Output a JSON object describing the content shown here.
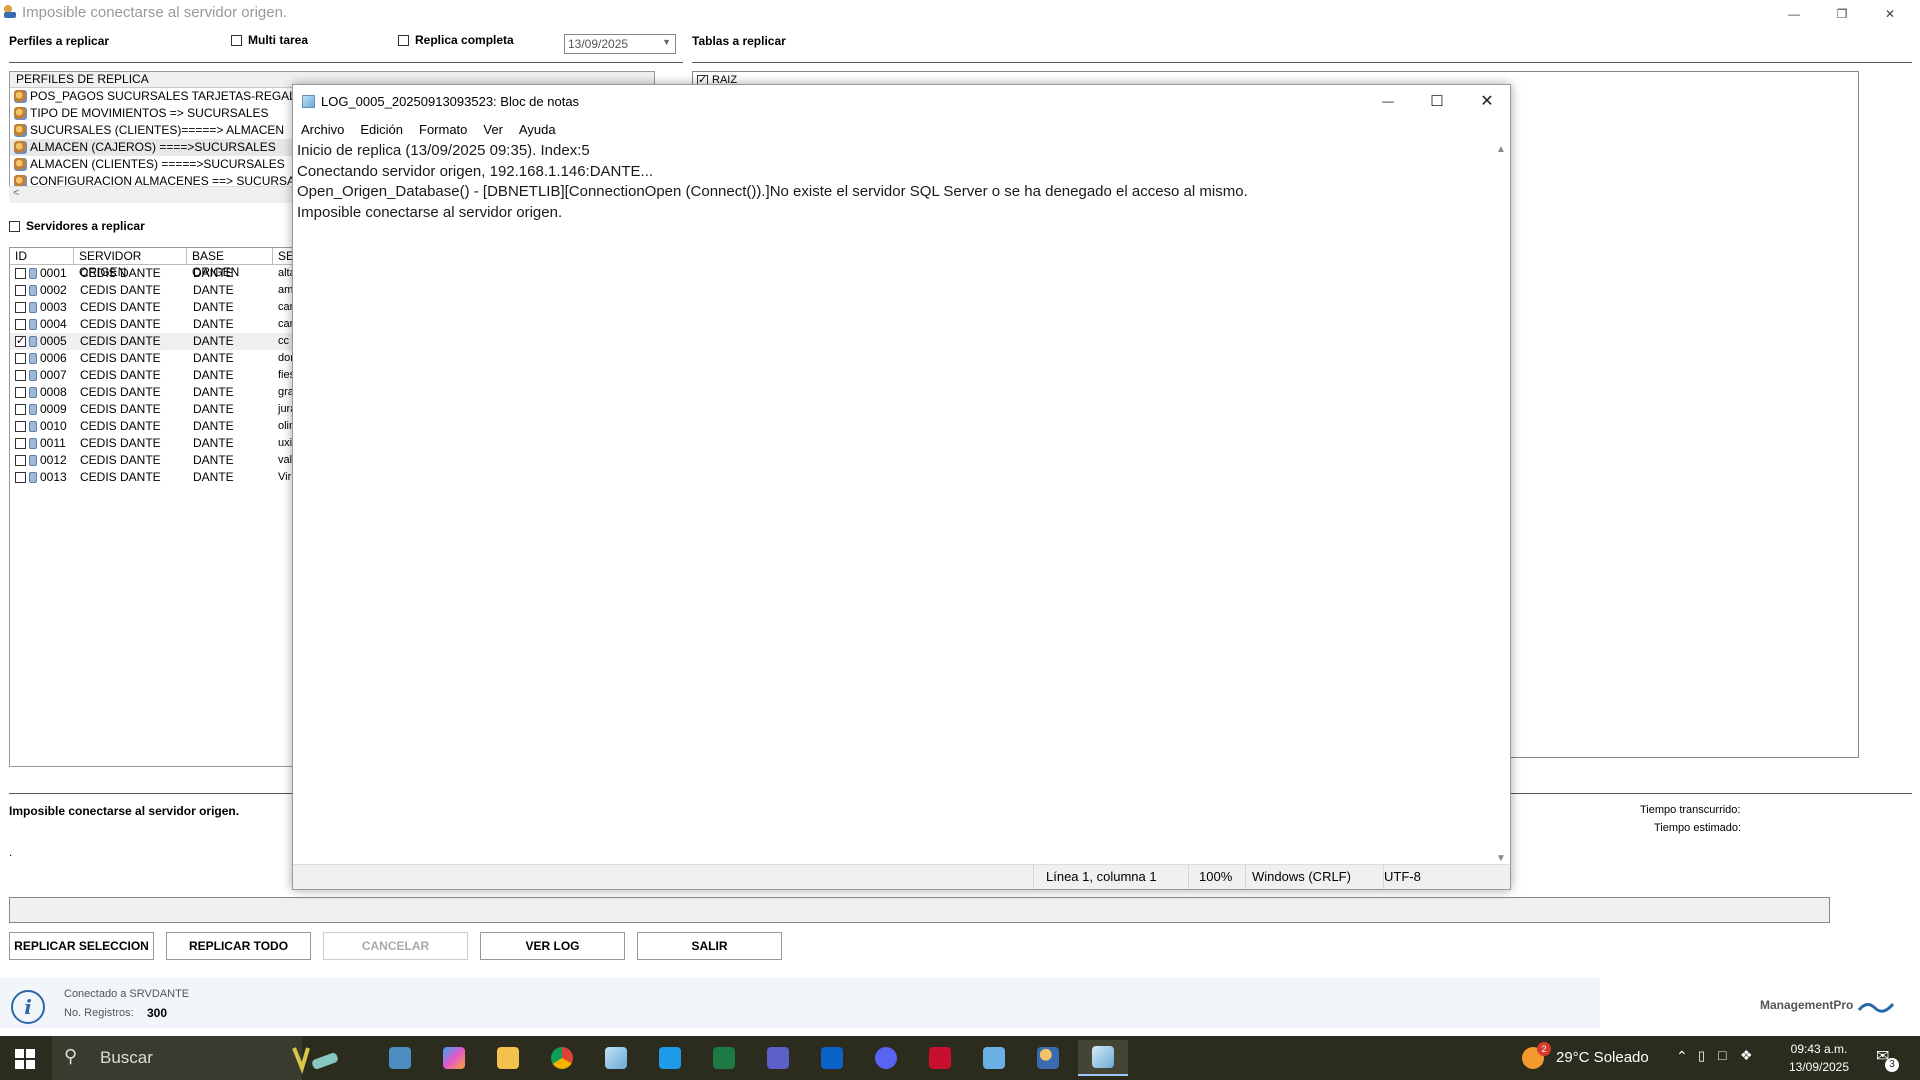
{
  "window": {
    "title": "Imposible conectarse al servidor origen."
  },
  "top": {
    "perfiles_label": "Perfiles a replicar",
    "multi_tarea": "Multi tarea",
    "replica_completa": "Replica completa",
    "date": "13/09/2025",
    "tablas_label": "Tablas a replicar",
    "servidores_label": "Servidores a replicar"
  },
  "profiles": {
    "header": "PERFILES DE REPLICA",
    "items": [
      "POS_PAGOS SUCURSALES TARJETAS-REGALO=>A",
      "TIPO DE MOVIMIENTOS => SUCURSALES",
      "SUCURSALES (CLIENTES)=====> ALMACEN",
      "ALMACEN (CAJEROS) ====>SUCURSALES",
      "ALMACEN  (CLIENTES) =====>SUCURSALES",
      "CONFIGURACION ALMACENES ==> SUCURSALES"
    ]
  },
  "tablas": {
    "root": "RAIZ"
  },
  "servers": {
    "headers": [
      "ID",
      "SERVIDOR ORIGEN",
      "BASE ORIGEN",
      "SE"
    ],
    "rows": [
      {
        "id": "0001",
        "srv": "CEDIS DANTE",
        "base": "DANTE",
        "se": "alta",
        "checked": false
      },
      {
        "id": "0002",
        "srv": "CEDIS DANTE",
        "base": "DANTE",
        "se": "am",
        "checked": false
      },
      {
        "id": "0003",
        "srv": "CEDIS DANTE",
        "base": "DANTE",
        "se": "car",
        "checked": false
      },
      {
        "id": "0004",
        "srv": "CEDIS DANTE",
        "base": "DANTE",
        "se": "car",
        "checked": false
      },
      {
        "id": "0005",
        "srv": "CEDIS DANTE",
        "base": "DANTE",
        "se": "cc",
        "checked": true
      },
      {
        "id": "0006",
        "srv": "CEDIS DANTE",
        "base": "DANTE",
        "se": "dor",
        "checked": false
      },
      {
        "id": "0007",
        "srv": "CEDIS DANTE",
        "base": "DANTE",
        "se": "fies",
        "checked": false
      },
      {
        "id": "0008",
        "srv": "CEDIS DANTE",
        "base": "DANTE",
        "se": "gra",
        "checked": false
      },
      {
        "id": "0009",
        "srv": "CEDIS DANTE",
        "base": "DANTE",
        "se": "jura",
        "checked": false
      },
      {
        "id": "0010",
        "srv": "CEDIS DANTE",
        "base": "DANTE",
        "se": "olin",
        "checked": false
      },
      {
        "id": "0011",
        "srv": "CEDIS DANTE",
        "base": "DANTE",
        "se": "uxi",
        "checked": false
      },
      {
        "id": "0012",
        "srv": "CEDIS DANTE",
        "base": "DANTE",
        "se": "val",
        "checked": false
      },
      {
        "id": "0013",
        "srv": "CEDIS DANTE",
        "base": "DANTE",
        "se": "Viri",
        "checked": false
      }
    ]
  },
  "notepad": {
    "title": "LOG_0005_20250913093523: Bloc de notas",
    "menu": [
      "Archivo",
      "Edición",
      "Formato",
      "Ver",
      "Ayuda"
    ],
    "lines": [
      "Inicio de replica (13/09/2025 09:35). Index:5",
      "Conectando servidor origen, 192.168.1.146:DANTE...",
      "Open_Origen_Database() - [DBNETLIB][ConnectionOpen (Connect()).]No existe el servidor SQL Server o se ha denegado el acceso al mismo.",
      "Imposible conectarse al servidor origen."
    ],
    "status": {
      "position": "Línea 1, columna 1",
      "zoom": "100%",
      "eol": "Windows (CRLF)",
      "encoding": "UTF-8"
    }
  },
  "bottom": {
    "status_message": "Imposible conectarse al servidor origen.",
    "dot": ".",
    "tiempo_transcurrido": "Tiempo transcurrido:",
    "tiempo_estimado": "Tiempo estimado:",
    "progress": 0,
    "buttons": {
      "replicar_seleccion": "REPLICAR SELECCION",
      "replicar_todo": "REPLICAR TODO",
      "cancelar": "CANCELAR",
      "ver_log": "VER LOG",
      "salir": "SALIR"
    },
    "conectado": "Conectado a SRVDANTE",
    "no_registros_label": "No. Registros:",
    "no_registros_value": "300",
    "brand": "ManagementPro"
  },
  "taskbar": {
    "search_placeholder": "Buscar",
    "weather_badge": "2",
    "weather": "29°C  Soleado",
    "time": "09:43 a.m.",
    "date": "13/09/2025",
    "notifications": "3"
  },
  "colors": {
    "accent": "#2a68a8",
    "taskbar": "#2b2b1e",
    "excel": "#1d7a45",
    "outlook": "#0a64c8",
    "teams": "#5b5fc7",
    "chrome_red": "#db4437"
  }
}
